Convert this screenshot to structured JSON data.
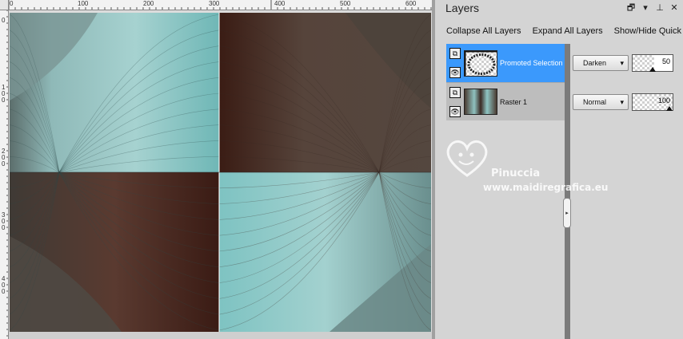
{
  "canvas": {
    "ruler_top_labels": [
      "0",
      "100",
      "200",
      "300",
      "400",
      "500",
      "600"
    ],
    "ruler_left_labels": [
      "0",
      "1",
      "0",
      "0",
      "2",
      "0",
      "0",
      "3",
      "0",
      "0",
      "4",
      "0",
      "0"
    ]
  },
  "layers_panel": {
    "title": "Layers",
    "controls": {
      "restore": "🗗",
      "menu": "▾",
      "pin": "⊥",
      "close": "✕"
    },
    "toolbar": {
      "collapse_all": "Collapse All Layers",
      "expand_all": "Expand All Layers",
      "show_hide_quick": "Show/Hide Quick"
    },
    "layers": [
      {
        "name": "Promoted Selection",
        "blend_mode": "Darken",
        "opacity": 50,
        "selected": true
      },
      {
        "name": "Raster 1",
        "blend_mode": "Normal",
        "opacity": 100,
        "selected": false
      }
    ],
    "watermark": {
      "name": "Pinuccia",
      "site": "www.maidiregrafica.eu"
    }
  },
  "colors": {
    "selection_blue": "#3b99fc",
    "panel_gray": "#d4d4d4",
    "canvas_brown": "#4a3a30",
    "canvas_teal": "#8fc6c4"
  }
}
